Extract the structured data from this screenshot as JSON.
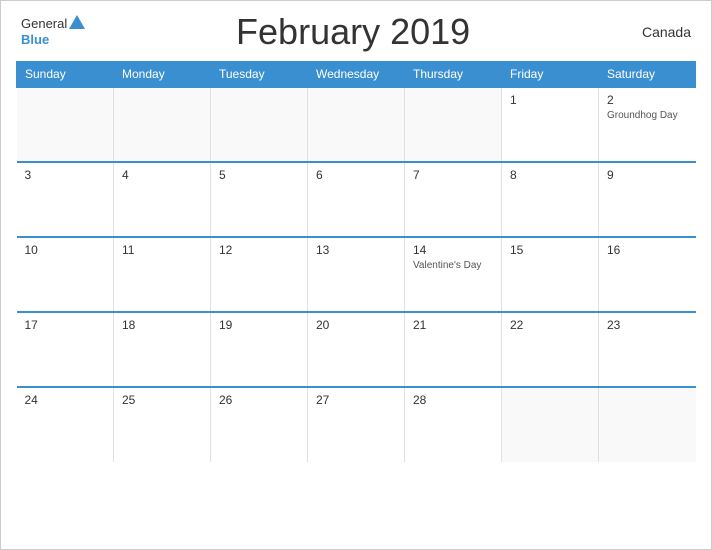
{
  "header": {
    "title": "February 2019",
    "country": "Canada",
    "logo_general": "General",
    "logo_blue": "Blue"
  },
  "days_of_week": [
    "Sunday",
    "Monday",
    "Tuesday",
    "Wednesday",
    "Thursday",
    "Friday",
    "Saturday"
  ],
  "weeks": [
    [
      {
        "day": "",
        "event": ""
      },
      {
        "day": "",
        "event": ""
      },
      {
        "day": "",
        "event": ""
      },
      {
        "day": "",
        "event": ""
      },
      {
        "day": "",
        "event": ""
      },
      {
        "day": "1",
        "event": ""
      },
      {
        "day": "2",
        "event": "Groundhog Day"
      }
    ],
    [
      {
        "day": "3",
        "event": ""
      },
      {
        "day": "4",
        "event": ""
      },
      {
        "day": "5",
        "event": ""
      },
      {
        "day": "6",
        "event": ""
      },
      {
        "day": "7",
        "event": ""
      },
      {
        "day": "8",
        "event": ""
      },
      {
        "day": "9",
        "event": ""
      }
    ],
    [
      {
        "day": "10",
        "event": ""
      },
      {
        "day": "11",
        "event": ""
      },
      {
        "day": "12",
        "event": ""
      },
      {
        "day": "13",
        "event": ""
      },
      {
        "day": "14",
        "event": "Valentine's Day"
      },
      {
        "day": "15",
        "event": ""
      },
      {
        "day": "16",
        "event": ""
      }
    ],
    [
      {
        "day": "17",
        "event": ""
      },
      {
        "day": "18",
        "event": ""
      },
      {
        "day": "19",
        "event": ""
      },
      {
        "day": "20",
        "event": ""
      },
      {
        "day": "21",
        "event": ""
      },
      {
        "day": "22",
        "event": ""
      },
      {
        "day": "23",
        "event": ""
      }
    ],
    [
      {
        "day": "24",
        "event": ""
      },
      {
        "day": "25",
        "event": ""
      },
      {
        "day": "26",
        "event": ""
      },
      {
        "day": "27",
        "event": ""
      },
      {
        "day": "28",
        "event": ""
      },
      {
        "day": "",
        "event": ""
      },
      {
        "day": "",
        "event": ""
      }
    ]
  ]
}
